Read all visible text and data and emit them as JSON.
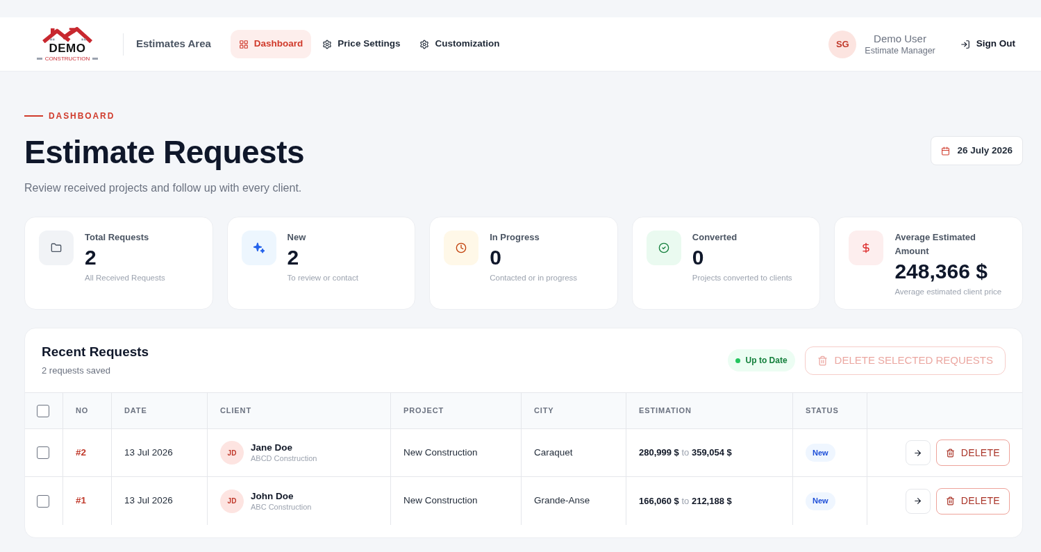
{
  "header": {
    "logo": {
      "name": "DEMO",
      "tagline": "CONSTRUCTION"
    },
    "area_title": "Estimates Area",
    "tabs": [
      {
        "label": "Dashboard",
        "selected": true
      },
      {
        "label": "Price Settings",
        "selected": false
      },
      {
        "label": "Customization",
        "selected": false
      }
    ],
    "user": {
      "initials": "SG",
      "name": "Demo User",
      "role": "Estimate Manager"
    },
    "sign_out": "Sign Out"
  },
  "page": {
    "eyebrow": "DASHBOARD",
    "title": "Estimate Requests",
    "subtitle": "Review received projects and follow up with every client.",
    "date": "26 July 2026"
  },
  "stats": [
    {
      "kind": "total",
      "label": "Total Requests",
      "value": "2",
      "caption": "All Received Requests"
    },
    {
      "kind": "new",
      "label": "New",
      "value": "2",
      "caption": "To review or contact"
    },
    {
      "kind": "progress",
      "label": "In Progress",
      "value": "0",
      "caption": "Contacted or in progress"
    },
    {
      "kind": "converted",
      "label": "Converted",
      "value": "0",
      "caption": "Projects converted to clients"
    },
    {
      "kind": "average",
      "label": "Average Estimated Amount",
      "value": "248,366 $",
      "caption": "Average estimated client price"
    }
  ],
  "recent": {
    "title": "Recent Requests",
    "count": "2 requests saved",
    "sync_status": "Up to Date",
    "delete_selected": {
      "label": "DELETE SELECTED REQUESTS",
      "disabled": true
    },
    "table": {
      "select_all_checked": false,
      "columns": [
        "NO",
        "DATE",
        "CLIENT",
        "PROJECT",
        "CITY",
        "ESTIMATION",
        "STATUS"
      ],
      "rows": [
        {
          "checked": false,
          "no": "#2",
          "date": "13 Jul 2026",
          "client": {
            "initials": "JD",
            "name": "Jane Doe",
            "company": "ABCD Construction"
          },
          "project": "New Construction",
          "city": "Caraquet",
          "estimation": "**280,999 $** to **359,054 $**",
          "status": "New",
          "delete_label": "DELETE"
        },
        {
          "checked": false,
          "no": "#1",
          "date": "13 Jul 2026",
          "client": {
            "initials": "JD",
            "name": "John Doe",
            "company": "ABC Construction"
          },
          "project": "New Construction",
          "city": "Grande-Anse",
          "estimation": "**166,060 $** to **212,188 $**",
          "status": "New",
          "delete_label": "DELETE"
        }
      ]
    }
  }
}
